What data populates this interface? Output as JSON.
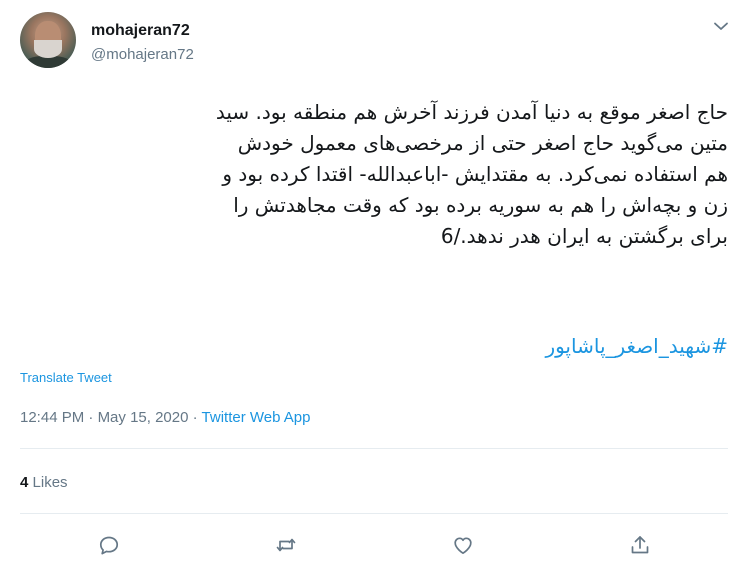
{
  "author": {
    "display_name": "mohajeran72",
    "handle": "@mohajeran72"
  },
  "tweet": {
    "text": "حاج اصغر موقع به دنیا آمدن فرزند آخرش هم منطقه بود. سید\nمتین می‌گوید حاج اصغر حتی از مرخصی‌های معمول خودش\nهم استفاده نمی‌کرد. به مقتدایش -اباعبدالله- اقتدا کرده بود و\nزن و بچه‌اش را هم به سوریه برده بود که وقت مجاهدتش را\nبرای برگشتن به ایران هدر ندهد./6",
    "hashtag": "#شهید_اصغر_پاشاپور",
    "translate_label": "Translate Tweet",
    "time": "12:44 PM",
    "separator": " · ",
    "date": "May 15, 2020",
    "source": "Twitter Web App"
  },
  "stats": {
    "likes_count": "4",
    "likes_label": "Likes"
  },
  "icons": {
    "more": "chevron-down-icon",
    "reply": "reply-icon",
    "retweet": "retweet-icon",
    "like": "heart-icon",
    "share": "share-icon"
  },
  "colors": {
    "link": "#1b95e0",
    "secondary_text": "#657786",
    "primary_text": "#14171a"
  }
}
